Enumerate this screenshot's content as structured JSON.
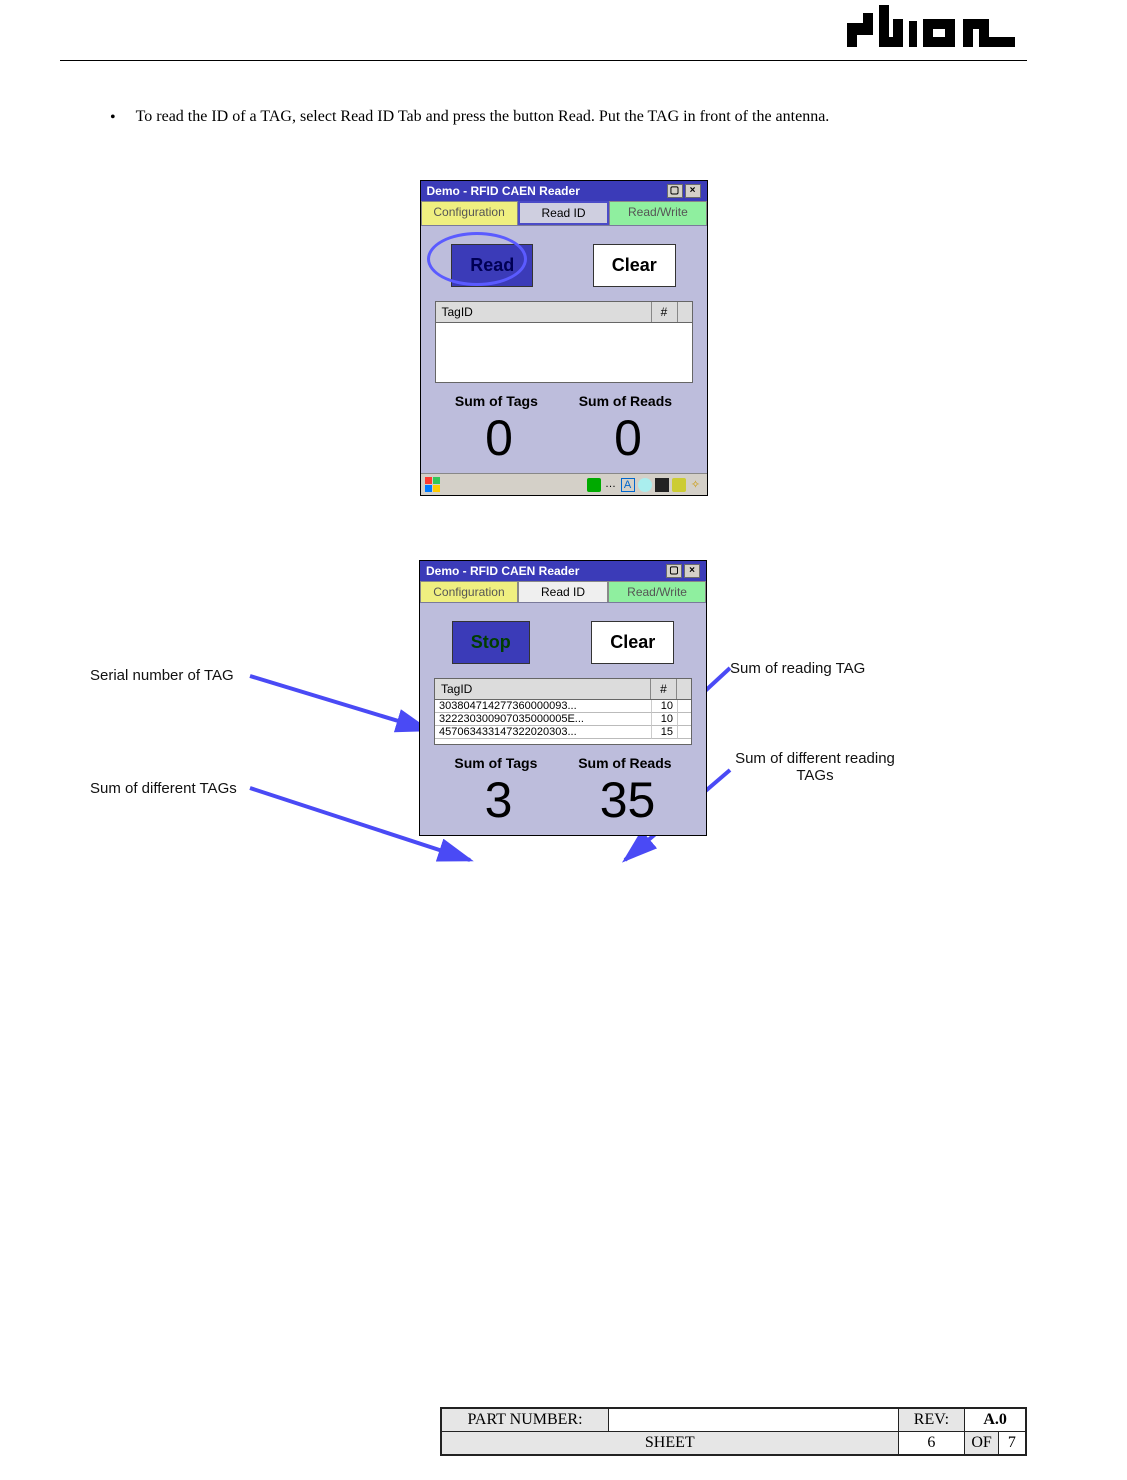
{
  "bullet_text": "To read the ID of a TAG, select Read ID Tab and press the button Read. Put the TAG in front of the antenna.",
  "app": {
    "title": "Demo - RFID CAEN Reader",
    "tabs": {
      "config": "Configuration",
      "readid": "Read ID",
      "readwrite": "Read/Write"
    },
    "buttons": {
      "read": "Read",
      "stop": "Stop",
      "clear": "Clear"
    },
    "table_headers": {
      "tagid": "TagID",
      "count": "#"
    },
    "labels": {
      "sum_tags": "Sum of Tags",
      "sum_reads": "Sum of Reads"
    }
  },
  "shot1": {
    "sum_tags": "0",
    "sum_reads": "0"
  },
  "shot2": {
    "rows": [
      {
        "id": "303804714277360000093...",
        "n": "10"
      },
      {
        "id": "322230300907035000005E...",
        "n": "10"
      },
      {
        "id": "457063433147322020303...",
        "n": "15"
      }
    ],
    "sum_tags": "3",
    "sum_reads": "35"
  },
  "annotations": {
    "serial": "Serial number of TAG",
    "diff_tags": "Sum of different TAGs",
    "sum_reading": "Sum of reading TAG",
    "diff_reading": "Sum of different reading TAGs"
  },
  "footer": {
    "part_number_label": "PART NUMBER:",
    "part_number_value": "",
    "rev_label": "REV:",
    "rev_value": "A.0",
    "sheet_label": "SHEET",
    "sheet_current": "6",
    "sheet_of": "OF",
    "sheet_total": "7"
  }
}
